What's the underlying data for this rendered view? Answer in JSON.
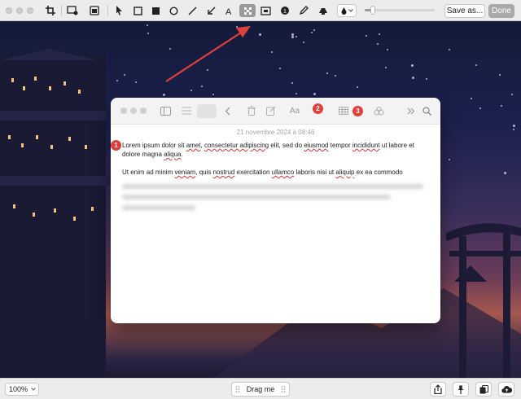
{
  "toolbar": {
    "save_label": "Save as...",
    "done_label": "Done",
    "tools": [
      "crop-icon",
      "screen-icon",
      "image-icon",
      "pointer-icon",
      "rectangle-icon",
      "filled-rectangle-icon",
      "ellipse-icon",
      "line-icon",
      "arrow-icon",
      "text-icon",
      "pixelate-icon",
      "blur-icon",
      "counter-icon",
      "pencil-icon",
      "highlighter-icon"
    ],
    "active_tool": "pixelate-icon",
    "color": "#1a1a1a",
    "stroke_level": 0.12
  },
  "note": {
    "date": "21 novembre 2024 à 08:46",
    "badges": [
      "1",
      "2",
      "3"
    ],
    "para1": {
      "t1": "Lorem ipsum dolor sit ",
      "w1": "amet",
      "t2": ", ",
      "w2": "consectetur adipiscing",
      "t3": " elit, sed do ",
      "w3": "eiusmod",
      "t4": " tempor ",
      "w4": "incididunt",
      "t5": " ut labore et dolore magna ",
      "w5": "aliqua",
      "t6": "."
    },
    "para2": {
      "t1": "Ut enim ad minim ",
      "w1": "veniam",
      "t2": ", quis ",
      "w2": "nostrud",
      "t3": " exercitation ",
      "w3": "ullamco",
      "t4": " laboris nisi ut ",
      "w4": "aliquip",
      "t5": " ex ea commodo"
    }
  },
  "bottombar": {
    "zoom": "100%",
    "drag_label": "Drag me"
  },
  "colors": {
    "badge": "#e0403b",
    "arrow": "#e0403b",
    "active_tool_bg": "#9a9a9a"
  }
}
